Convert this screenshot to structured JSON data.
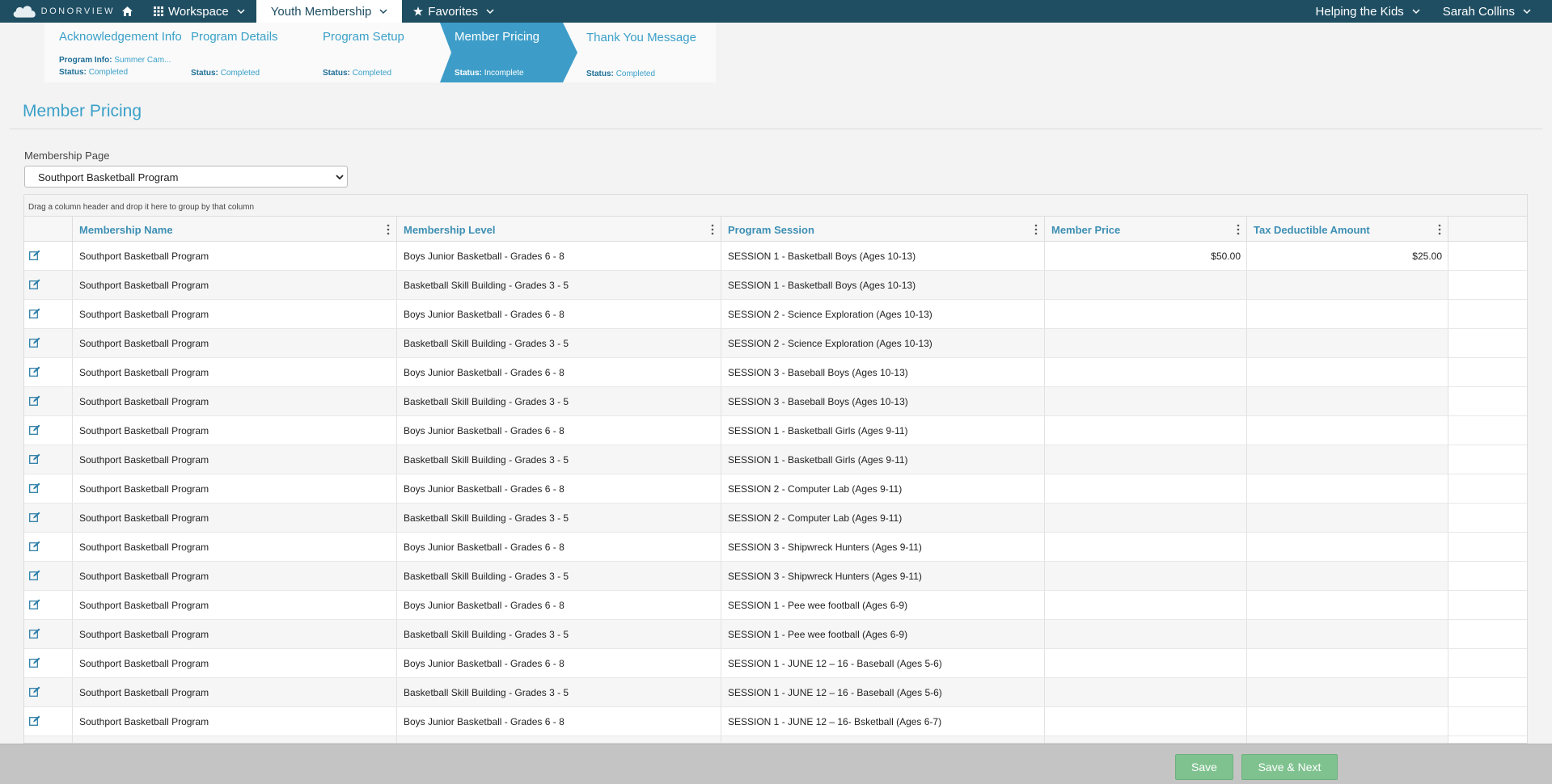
{
  "topbar": {
    "logo_text": "DONORVIEW",
    "workspace_label": "Workspace",
    "active_tab_label": "Youth Membership",
    "favorites_label": "Favorites",
    "org_label": "Helping the Kids",
    "user_label": "Sarah Collins"
  },
  "steps": [
    {
      "title": "Acknowledgement Info",
      "sub1_key": "Program Info:",
      "sub1_val": "Summer Cam...",
      "status_key": "Status:",
      "status_val": "Completed"
    },
    {
      "title": "Program Details",
      "status_key": "Status:",
      "status_val": "Completed"
    },
    {
      "title": "Program Setup",
      "status_key": "Status:",
      "status_val": "Completed"
    },
    {
      "title": "Member Pricing",
      "status_key": "Status:",
      "status_val": "Incomplete"
    },
    {
      "title": "Thank You Message",
      "status_key": "Status:",
      "status_val": "Completed"
    }
  ],
  "page": {
    "title": "Member Pricing",
    "membership_page_label": "Membership Page",
    "membership_page_value": "Southport Basketball Program"
  },
  "grid": {
    "group_hint": "Drag a column header and drop it here to group by that column",
    "columns": [
      "Membership Name",
      "Membership Level",
      "Program Session",
      "Member Price",
      "Tax Deductible Amount"
    ],
    "rows": [
      [
        "Southport Basketball Program",
        "Boys Junior Basketball - Grades 6 - 8",
        "SESSION 1 - Basketball Boys (Ages 10-13)",
        "$50.00",
        "$25.00"
      ],
      [
        "Southport Basketball Program",
        "Basketball Skill Building - Grades 3 - 5",
        "SESSION 1 - Basketball Boys (Ages 10-13)",
        "",
        ""
      ],
      [
        "Southport Basketball Program",
        "Boys Junior Basketball - Grades 6 - 8",
        "SESSION 2 - Science Exploration (Ages 10-13)",
        "",
        ""
      ],
      [
        "Southport Basketball Program",
        "Basketball Skill Building - Grades 3 - 5",
        "SESSION 2 - Science Exploration (Ages 10-13)",
        "",
        ""
      ],
      [
        "Southport Basketball Program",
        "Boys Junior Basketball - Grades 6 - 8",
        "SESSION 3 - Baseball Boys (Ages 10-13)",
        "",
        ""
      ],
      [
        "Southport Basketball Program",
        "Basketball Skill Building - Grades 3 - 5",
        "SESSION 3 - Baseball Boys (Ages 10-13)",
        "",
        ""
      ],
      [
        "Southport Basketball Program",
        "Boys Junior Basketball - Grades 6 - 8",
        "SESSION 1 - Basketball Girls (Ages 9-11)",
        "",
        ""
      ],
      [
        "Southport Basketball Program",
        "Basketball Skill Building - Grades 3 - 5",
        "SESSION 1 - Basketball Girls (Ages 9-11)",
        "",
        ""
      ],
      [
        "Southport Basketball Program",
        "Boys Junior Basketball - Grades 6 - 8",
        "SESSION 2 - Computer Lab (Ages 9-11)",
        "",
        ""
      ],
      [
        "Southport Basketball Program",
        "Basketball Skill Building - Grades 3 - 5",
        "SESSION 2 - Computer Lab (Ages 9-11)",
        "",
        ""
      ],
      [
        "Southport Basketball Program",
        "Boys Junior Basketball - Grades 6 - 8",
        "SESSION 3 - Shipwreck Hunters (Ages 9-11)",
        "",
        ""
      ],
      [
        "Southport Basketball Program",
        "Basketball Skill Building - Grades 3 - 5",
        "SESSION 3 - Shipwreck Hunters (Ages 9-11)",
        "",
        ""
      ],
      [
        "Southport Basketball Program",
        "Boys Junior Basketball - Grades 6 - 8",
        "SESSION 1 - Pee wee football (Ages 6-9)",
        "",
        ""
      ],
      [
        "Southport Basketball Program",
        "Basketball Skill Building - Grades 3 - 5",
        "SESSION 1 - Pee wee football (Ages 6-9)",
        "",
        ""
      ],
      [
        "Southport Basketball Program",
        "Boys Junior Basketball - Grades 6 - 8",
        "SESSION 1 - JUNE 12 – 16 - Baseball (Ages 5-6)",
        "",
        ""
      ],
      [
        "Southport Basketball Program",
        "Basketball Skill Building - Grades 3 - 5",
        "SESSION 1 - JUNE 12 – 16 - Baseball (Ages 5-6)",
        "",
        ""
      ],
      [
        "Southport Basketball Program",
        "Boys Junior Basketball - Grades 6 - 8",
        "SESSION 1 - JUNE 12 – 16- Bsketball (Ages 6-7)",
        "",
        ""
      ],
      [
        "",
        "",
        "",
        "",
        ""
      ]
    ]
  },
  "footer": {
    "save_label": "Save",
    "save_next_label": "Save & Next"
  },
  "icons": {
    "home": "home-icon",
    "grid": "grid-icon",
    "star": "star-icon",
    "edit": "edit-icon",
    "menu": "kebab-menu-icon",
    "caret": "chevron-down-icon"
  },
  "colors": {
    "topbar": "#1f4e62",
    "accent": "#3aa0c8",
    "active_step": "#3d9dc8",
    "button": "#7fc28f"
  }
}
